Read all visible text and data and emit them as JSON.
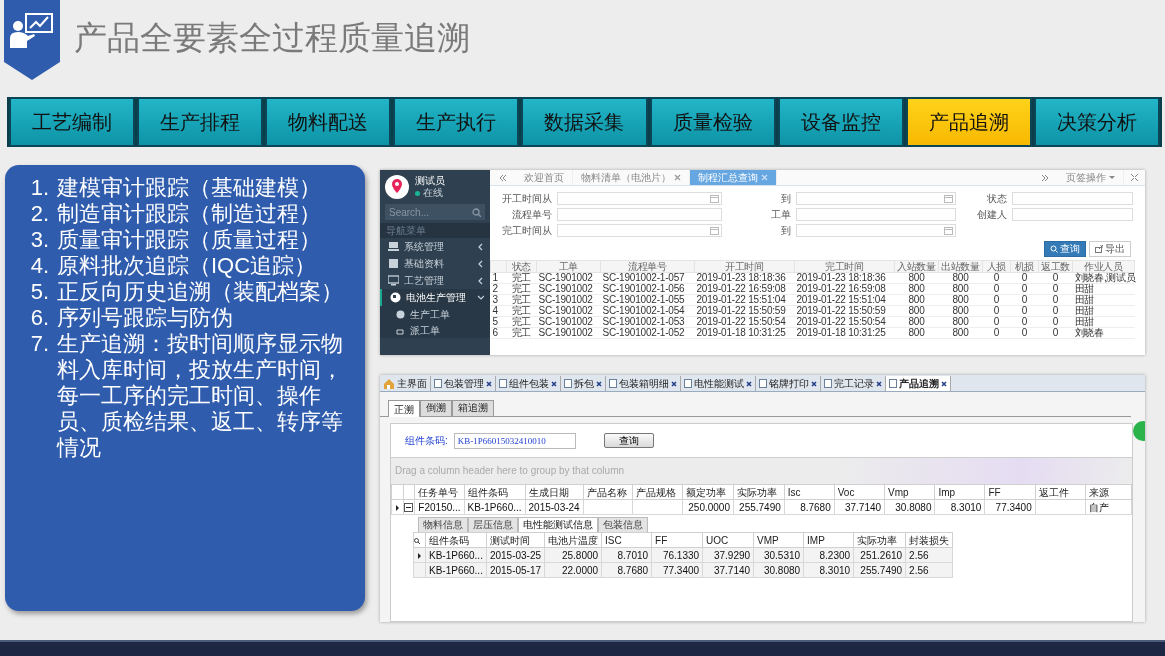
{
  "slide": {
    "title": "产品全要素全过程质量追溯"
  },
  "modules": [
    {
      "label": "工艺编制",
      "selected": false
    },
    {
      "label": "生产排程",
      "selected": false
    },
    {
      "label": "物料配送",
      "selected": false
    },
    {
      "label": "生产执行",
      "selected": false
    },
    {
      "label": "数据采集",
      "selected": false
    },
    {
      "label": "质量检验",
      "selected": false
    },
    {
      "label": "设备监控",
      "selected": false
    },
    {
      "label": "产品追溯",
      "selected": true
    },
    {
      "label": "决策分析",
      "selected": false
    }
  ],
  "features": [
    {
      "number": "1.",
      "text": "建模审计跟踪（基础建模）"
    },
    {
      "number": "2.",
      "text": "制造审计跟踪（制造过程）"
    },
    {
      "number": "3.",
      "text": "质量审计跟踪（质量过程）"
    },
    {
      "number": "4.",
      "text": "原料批次追踪（IQC追踪）"
    },
    {
      "number": "5.",
      "text": "正反向历史追溯（装配档案）"
    },
    {
      "number": "6.",
      "text": "序列号跟踪与防伪"
    },
    {
      "number": "7.",
      "text": "生产追溯：按时间顺序显示物料入库时间，投放生产时间，每一工序的完工时间、操作员、质检结果、返工、转序等情况"
    }
  ],
  "web_app": {
    "user": {
      "name": "测试员",
      "status": "在线"
    },
    "search": {
      "placeholder": "Search..."
    },
    "menu_header": "导航菜单",
    "menu": [
      {
        "label": "系统管理",
        "expanded": false
      },
      {
        "label": "基础资料",
        "expanded": false
      },
      {
        "label": "工艺管理",
        "expanded": false
      },
      {
        "label": "电池生产管理",
        "expanded": true,
        "children": [
          {
            "label": "生产工单"
          },
          {
            "label": "派工单"
          }
        ]
      }
    ],
    "tabs": [
      {
        "label": "欢迎首页",
        "selected": false,
        "closable": false
      },
      {
        "label": "物料清单（电池片）",
        "selected": false,
        "closable": true
      },
      {
        "label": "制程汇总查询",
        "selected": true,
        "closable": true
      }
    ],
    "tab_menu": "页签操作",
    "filters": [
      {
        "label": "开工时间从",
        "kind": "date"
      },
      {
        "label": "到",
        "kind": "date"
      },
      {
        "label": "状态",
        "kind": "text"
      },
      {
        "label": "流程单号",
        "kind": "text"
      },
      {
        "label": "工单",
        "kind": "text"
      },
      {
        "label": "创建人",
        "kind": "text"
      },
      {
        "label": "完工时间从",
        "kind": "date"
      },
      {
        "label": "到",
        "kind": "date"
      }
    ],
    "buttons": [
      {
        "label": "查询",
        "primary": true
      },
      {
        "label": "导出",
        "primary": false
      }
    ],
    "table": {
      "columns": [
        "状态",
        "工单",
        "流程单号",
        "开工时间",
        "完工时间",
        "入站数量",
        "出站数量",
        "人损",
        "机损",
        "返工数",
        "作业人员"
      ],
      "rows": [
        {
          "number": "1",
          "cells": [
            "完工",
            "SC-1901002",
            "SC-1901002-1-057",
            "2019-01-23 18:18:36",
            "2019-01-23 18:18:36",
            "800",
            "800",
            "0",
            "0",
            "0",
            "刘晓春,测试员"
          ]
        },
        {
          "number": "2",
          "cells": [
            "完工",
            "SC-1901002",
            "SC-1901002-1-056",
            "2019-01-22 16:59:08",
            "2019-01-22 16:59:08",
            "800",
            "800",
            "0",
            "0",
            "0",
            "田甜"
          ]
        },
        {
          "number": "3",
          "cells": [
            "完工",
            "SC-1901002",
            "SC-1901002-1-055",
            "2019-01-22 15:51:04",
            "2019-01-22 15:51:04",
            "800",
            "800",
            "0",
            "0",
            "0",
            "田甜"
          ]
        },
        {
          "number": "4",
          "cells": [
            "完工",
            "SC-1901002",
            "SC-1901002-1-054",
            "2019-01-22 15:50:59",
            "2019-01-22 15:50:59",
            "800",
            "800",
            "0",
            "0",
            "0",
            "田甜"
          ]
        },
        {
          "number": "5",
          "cells": [
            "完工",
            "SC-1901002",
            "SC-1901002-1-053",
            "2019-01-22 15:50:54",
            "2019-01-22 15:50:54",
            "800",
            "800",
            "0",
            "0",
            "0",
            "田甜"
          ]
        },
        {
          "number": "6",
          "cells": [
            "完工",
            "SC-1901002",
            "SC-1901002-1-052",
            "2019-01-18 10:31:25",
            "2019-01-18 10:31:25",
            "800",
            "800",
            "0",
            "0",
            "0",
            "刘晓春"
          ]
        }
      ]
    }
  },
  "desktop_app": {
    "doc_tabs": [
      {
        "label": "主界面",
        "selected": false,
        "closable": false
      },
      {
        "label": "包装管理",
        "selected": false,
        "closable": true
      },
      {
        "label": "组件包装",
        "selected": false,
        "closable": true
      },
      {
        "label": "拆包",
        "selected": false,
        "closable": true
      },
      {
        "label": "包装箱明细",
        "selected": false,
        "closable": true
      },
      {
        "label": "电性能测试",
        "selected": false,
        "closable": true
      },
      {
        "label": "铭牌打印",
        "selected": false,
        "closable": true
      },
      {
        "label": "完工记录",
        "selected": false,
        "closable": true
      },
      {
        "label": "产品追溯",
        "selected": true,
        "closable": true
      }
    ],
    "trace_tabs": [
      {
        "label": "正溯",
        "selected": true
      },
      {
        "label": "倒溯",
        "selected": false
      },
      {
        "label": "箱追溯",
        "selected": false
      }
    ],
    "barcode": {
      "label": "组件条码:",
      "value": "KB-1P66015032410010"
    },
    "query_button": "查询",
    "group_hint": "Drag a column header here to group by that column",
    "grid": {
      "columns": [
        {
          "label": "任务单号",
          "numeric": false
        },
        {
          "label": "组件条码",
          "numeric": false
        },
        {
          "label": "生成日期",
          "numeric": false
        },
        {
          "label": "产品名称",
          "numeric": false
        },
        {
          "label": "产品规格",
          "numeric": false
        },
        {
          "label": "额定功率",
          "numeric": true
        },
        {
          "label": "实际功率",
          "numeric": true
        },
        {
          "label": "Isc",
          "numeric": true
        },
        {
          "label": "Voc",
          "numeric": true
        },
        {
          "label": "Vmp",
          "numeric": true
        },
        {
          "label": "Imp",
          "numeric": true
        },
        {
          "label": "FF",
          "numeric": true
        },
        {
          "label": "返工件"
        },
        {
          "label": "来源",
          "numeric": false
        }
      ],
      "rows": [
        {
          "selected": true,
          "expanded": true,
          "cells": [
            "F20150...",
            "KB-1P660...",
            "2015-03-24",
            null,
            null,
            "250.0000",
            "255.7490",
            "8.7680",
            "37.7140",
            "30.8080",
            "8.3010",
            "77.3400",
            null,
            "自产"
          ]
        }
      ]
    },
    "detail_tabs": [
      {
        "label": "物料信息",
        "selected": false
      },
      {
        "label": "层压信息",
        "selected": false
      },
      {
        "label": "电性能测试信息",
        "selected": true
      },
      {
        "label": "包装信息",
        "selected": false
      }
    ],
    "detail_grid": {
      "columns": [
        {
          "label": "组件条码"
        },
        {
          "label": "测试时间"
        },
        {
          "label": "电池片温度",
          "numeric": true
        },
        {
          "label": "ISC",
          "numeric": true
        },
        {
          "label": "FF",
          "numeric": true
        },
        {
          "label": "UOC",
          "numeric": true
        },
        {
          "label": "VMP",
          "numeric": true
        },
        {
          "label": "IMP",
          "numeric": true
        },
        {
          "label": "实际功率",
          "numeric": true
        },
        {
          "label": "封装损失",
          "numeric": false
        }
      ],
      "rows": [
        {
          "selected": true,
          "cells": [
            "KB-1P660...",
            "2015-03-25",
            "25.8000",
            "8.7010",
            "76.1330",
            "37.9290",
            "30.5310",
            "8.2300",
            "251.2610",
            "2.56"
          ]
        },
        {
          "selected": false,
          "cells": [
            "KB-1P660...",
            "2015-05-17",
            "22.0000",
            "8.7680",
            "77.3400",
            "37.7140",
            "30.8080",
            "8.3010",
            "255.7490",
            "2.56"
          ]
        }
      ]
    }
  }
}
